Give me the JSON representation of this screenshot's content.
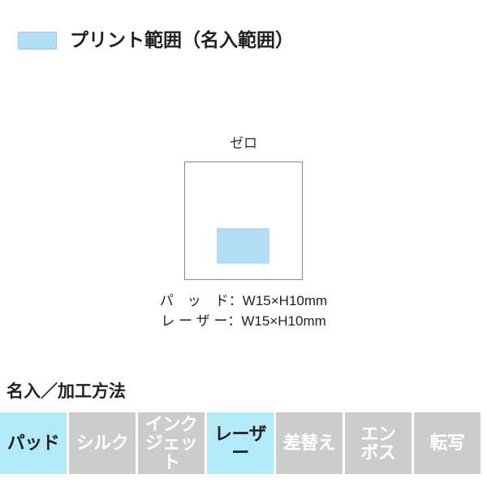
{
  "legend": {
    "swatch_color": "#b3ddf7",
    "label": "プリント範囲（名入範囲）"
  },
  "diagram": {
    "title": "ゼロ",
    "print_area_color": "#b3ddf7",
    "specs": [
      "パ　ッ　ド：W15×H10mm",
      "レ ー ザ ー：W15×H10mm"
    ]
  },
  "methods": {
    "heading": "名入／加工方法",
    "active_color": "#b3eaf8",
    "inactive_color": "#cccccc",
    "items": [
      {
        "label": "パッド",
        "enabled": true
      },
      {
        "label": "シルク",
        "enabled": false
      },
      {
        "label": "インク\nジェット",
        "enabled": false
      },
      {
        "label": "レーザー",
        "enabled": true
      },
      {
        "label": "差替え",
        "enabled": false
      },
      {
        "label": "エン\nボス",
        "enabled": false
      },
      {
        "label": "転写",
        "enabled": false
      }
    ]
  }
}
